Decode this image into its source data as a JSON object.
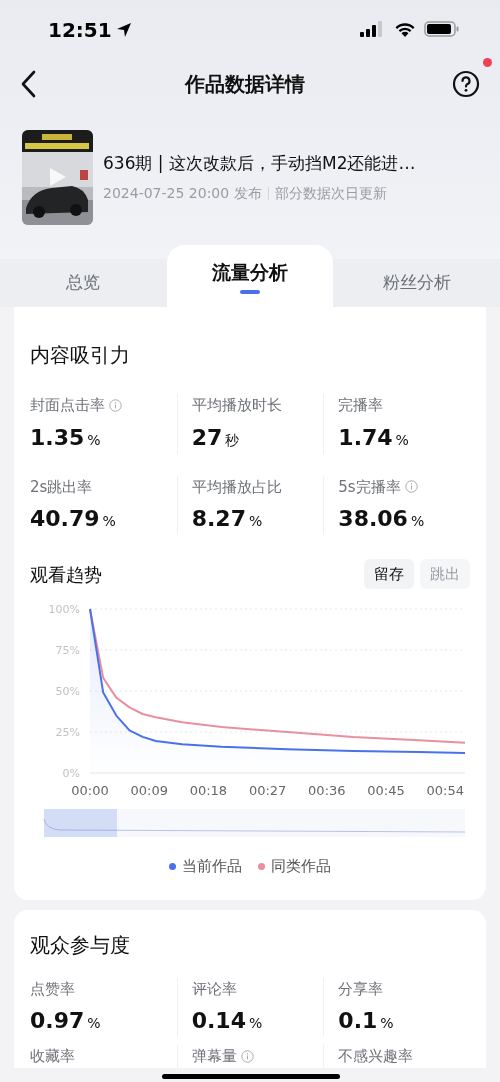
{
  "status_bar": {
    "time": "12:51"
  },
  "header": {
    "title": "作品数据详情",
    "notification_dot": true
  },
  "video": {
    "title": "636期 | 这次改款后，手动挡M2还能进…",
    "published": "2024-07-25 20:00 发布",
    "note": "部分数据次日更新"
  },
  "tabs": [
    {
      "label": "总览",
      "selected": false
    },
    {
      "label": "流量分析",
      "selected": true
    },
    {
      "label": "粉丝分析",
      "selected": false
    }
  ],
  "attraction": {
    "title": "内容吸引力",
    "metrics": [
      {
        "label": "封面点击率",
        "value": "1.35",
        "unit": "%",
        "info": true
      },
      {
        "label": "平均播放时长",
        "value": "27",
        "unit": "秒",
        "info": false
      },
      {
        "label": "完播率",
        "value": "1.74",
        "unit": "%",
        "info": false
      },
      {
        "label": "2s跳出率",
        "value": "40.79",
        "unit": "%",
        "info": false
      },
      {
        "label": "平均播放占比",
        "value": "8.27",
        "unit": "%",
        "info": false
      },
      {
        "label": "5s完播率",
        "value": "38.06",
        "unit": "%",
        "info": true
      }
    ],
    "trend": {
      "title": "观看趋势",
      "toggles": [
        {
          "label": "留存",
          "selected": true
        },
        {
          "label": "跳出",
          "selected": false
        }
      ],
      "chart_data": {
        "type": "line",
        "grid": true,
        "x": [
          0,
          2,
          4,
          6,
          8,
          10,
          14,
          20,
          30,
          40,
          50,
          57
        ],
        "series": [
          {
            "name": "当前作品",
            "color": "#4a72e8",
            "type": "area",
            "values": [
              100,
              49,
              35,
              26,
              22,
              19.5,
              17.5,
              16,
              14.5,
              13.5,
              12.8,
              12.2
            ]
          },
          {
            "name": "同类作品",
            "color": "#e8909e",
            "type": "line",
            "values": [
              100,
              58,
              46,
              40,
              36,
              34,
              31,
              28,
              25,
              22,
              20,
              18.5
            ]
          }
        ],
        "xlim": [
          0,
          57
        ],
        "ylim": [
          0,
          100
        ],
        "xticks": [
          {
            "value": 0,
            "label": "00:00"
          },
          {
            "value": 9,
            "label": "00:09"
          },
          {
            "value": 18,
            "label": "00:18"
          },
          {
            "value": 27,
            "label": "00:27"
          },
          {
            "value": 36,
            "label": "00:36"
          },
          {
            "value": 45,
            "label": "00:45"
          },
          {
            "value": 54,
            "label": "00:54"
          }
        ],
        "yticks": [
          {
            "value": 0,
            "label": "0%"
          },
          {
            "value": 25,
            "label": "25%"
          },
          {
            "value": 50,
            "label": "50%"
          },
          {
            "value": 75,
            "label": "75%"
          },
          {
            "value": 100,
            "label": "100%"
          }
        ]
      }
    }
  },
  "engagement": {
    "title": "观众参与度",
    "metrics": [
      {
        "label": "点赞率",
        "value": "0.97",
        "unit": "%",
        "info": false
      },
      {
        "label": "评论率",
        "value": "0.14",
        "unit": "%",
        "info": false
      },
      {
        "label": "分享率",
        "value": "0.1",
        "unit": "%",
        "info": false
      },
      {
        "label": "收藏率",
        "info": false
      },
      {
        "label": "弹幕量",
        "info": true
      },
      {
        "label": "不感兴趣率",
        "info": false
      }
    ]
  }
}
